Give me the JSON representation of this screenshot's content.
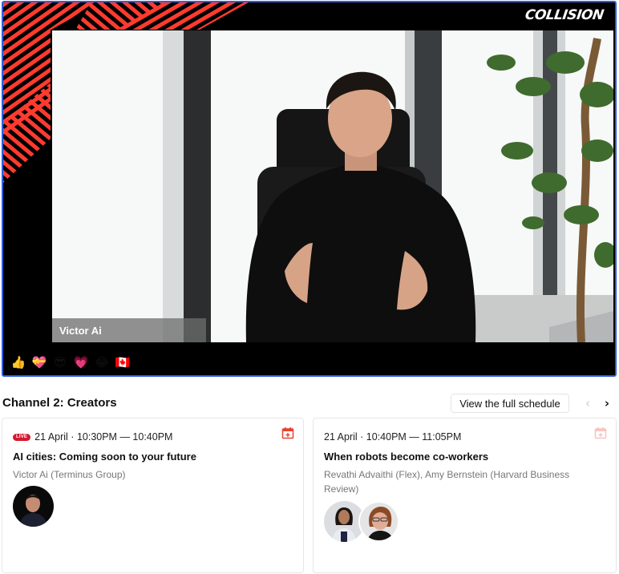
{
  "player": {
    "brand_logo": "COLLISION",
    "speaker_name": "Victor Ai",
    "accent_color": "#ff3b2f",
    "border_color": "#2d5fe0",
    "reactions": [
      {
        "name": "thumbs-up",
        "glyph": "👍"
      },
      {
        "name": "sparkle-hearts",
        "glyph": "💝"
      },
      {
        "name": "cool-fire",
        "glyph": "😎"
      },
      {
        "name": "heart-eyes",
        "glyph": "💗"
      },
      {
        "name": "laughing-tears",
        "glyph": "😂"
      },
      {
        "name": "canada-flag",
        "glyph": "🇨🇦"
      }
    ]
  },
  "schedule": {
    "channel_title": "Channel 2: Creators",
    "view_schedule_label": "View the full schedule",
    "prev_icon": "‹",
    "next_icon": "›",
    "sessions": [
      {
        "live": true,
        "live_label": "LIVE",
        "time": "21 April · 10:30PM — 10:40PM",
        "title": "AI cities: Coming soon to your future",
        "speakers": "Victor Ai (Terminus Group)",
        "avatars": [
          "Victor Ai"
        ]
      },
      {
        "live": false,
        "time": "21 April · 10:40PM — 11:05PM",
        "title": "When robots become co-workers",
        "speakers": "Revathi Advaithi (Flex), Amy Bernstein (Harvard Business Review)",
        "avatars": [
          "Revathi Advaithi",
          "Amy Bernstein"
        ]
      }
    ]
  }
}
